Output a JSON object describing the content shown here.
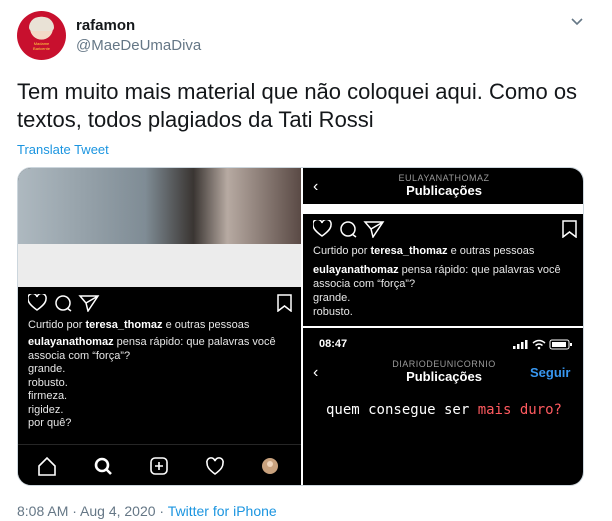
{
  "tweet": {
    "display_name": "rafamon",
    "handle": "@MaeDeUmaDiva",
    "avatar_text": "Madame Baricente",
    "text": "Tem muito mais material que não coloquei aqui. Como os textos, todos plagiados da Tati Rossi",
    "translate_label": "Translate Tweet",
    "timestamp": "8:08 AM · Aug 4, 2020 · ",
    "source": "Twitter for iPhone"
  },
  "panel_left": {
    "liked_prefix": "Curtido por ",
    "liked_user": "teresa_thomaz",
    "liked_suffix": " e outras pessoas",
    "caption_user": "eulayanathomaz",
    "caption_text": " pensa rápido: que palavras você associa com “força”?",
    "caption_lines": "grande.\nrobusto.\nfirmeza.\nrigidez.\npor quê?"
  },
  "panel_top_right": {
    "account": "EULAYANATHOMAZ",
    "title": "Publicações",
    "liked_prefix": "Curtido por ",
    "liked_user": "teresa_thomaz",
    "liked_suffix": " e outras pessoas",
    "caption_user": "eulayanathomaz",
    "caption_text": " pensa rápido: que palavras você associa com “força”?",
    "caption_lines": "grande.\nrobusto."
  },
  "panel_bottom_right": {
    "time": "08:47",
    "account": "DIARIODEUNICORNIO",
    "title": "Publicações",
    "follow_label": "Seguir",
    "quote_pre": "quem consegue ser ",
    "quote_hl": "mais duro?"
  },
  "icons": [
    "chevron-down-icon",
    "heart-icon",
    "comment-icon",
    "send-icon",
    "bookmark-icon",
    "home-icon",
    "search-icon",
    "add-icon",
    "profile-icon",
    "back-icon",
    "signal-icon",
    "wifi-icon",
    "battery-icon"
  ],
  "colors": {
    "link": "#1b95e0",
    "muted": "#657786",
    "ig_blue": "#3897f0",
    "highlight": "#ff5a5f"
  }
}
